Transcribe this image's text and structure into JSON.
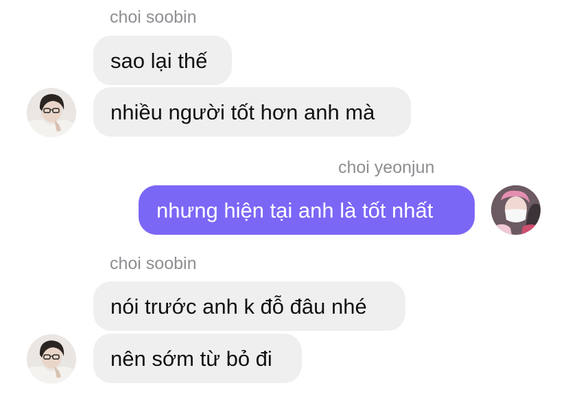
{
  "conversation": {
    "groups": [
      {
        "sender": "choi soobin",
        "direction": "incoming",
        "messages": [
          "sao lại thế",
          "nhiều người tốt hơn anh mà"
        ],
        "avatar_icon": "avatar-soobin"
      },
      {
        "sender": "choi yeonjun",
        "direction": "outgoing",
        "messages": [
          "nhưng hiện tại anh là tốt nhất"
        ],
        "avatar_icon": "avatar-yeonjun"
      },
      {
        "sender": "choi soobin",
        "direction": "incoming",
        "messages": [
          "nói trước anh k đỗ đâu nhé",
          "nên sớm từ bỏ đi"
        ],
        "avatar_icon": "avatar-soobin"
      }
    ]
  },
  "colors": {
    "incoming_bubble": "#efefef",
    "outgoing_bubble": "#7b67f6",
    "sender_name": "#8e8e93",
    "background": "#ffffff"
  }
}
